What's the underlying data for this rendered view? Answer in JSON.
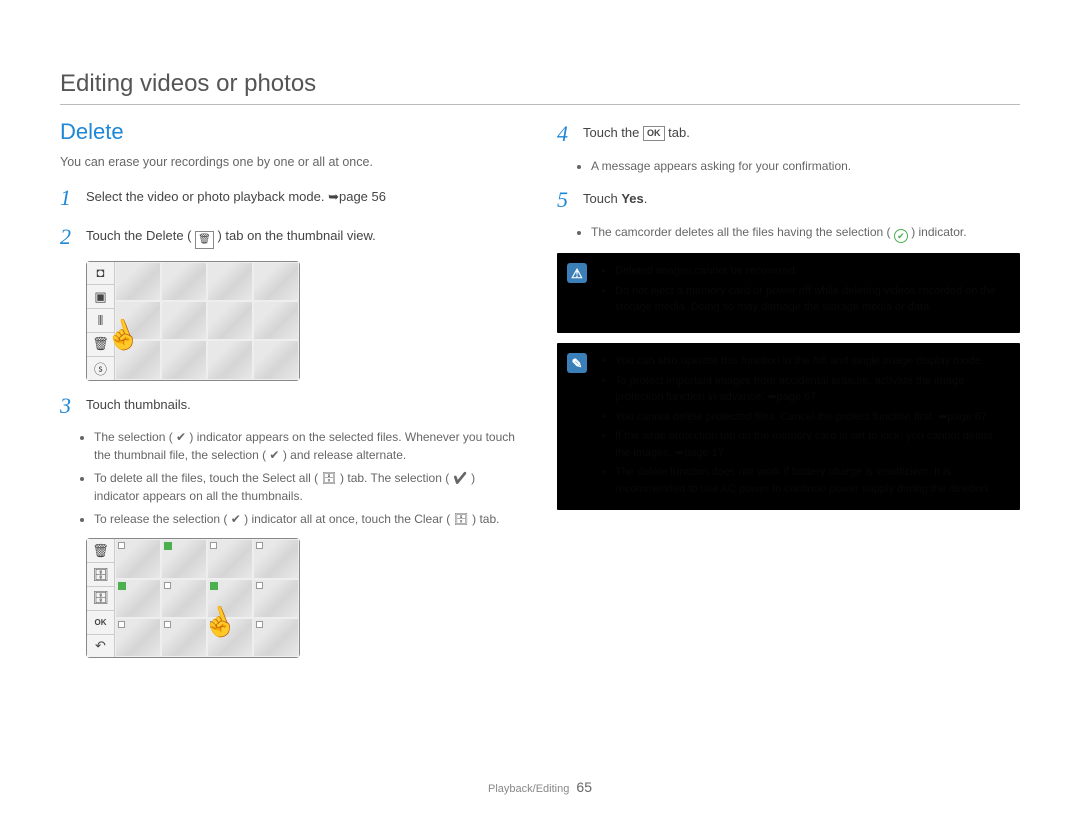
{
  "page": {
    "title": "Editing videos or photos",
    "section": "Delete",
    "intro": "You can erase your recordings one by one or all at once.",
    "footer_section": "Playback/Editing",
    "page_number": "65"
  },
  "steps": {
    "s1": "Select the video or photo playback mode. ➥page 56",
    "s2_prefix": "Touch the Delete (",
    "s2_suffix": ") tab on the thumbnail view.",
    "s3": "Touch thumbnails.",
    "s4_prefix": "Touch the ",
    "s4_suffix": " tab.",
    "s4_ok": "OK",
    "s5_prefix": "Touch ",
    "s5_bold": "Yes",
    "s5_suffix": "."
  },
  "step3_bullets": {
    "b1": "The selection ( ✔ ) indicator appears on the selected files. Whenever you touch the thumbnail file, the selection ( ✔ ) and release alternate.",
    "b2": "To delete all the files, touch the Select all ( 🗄 ) tab. The selection ( ✔ ) indicator appears on all the thumbnails.",
    "b3": "To release the selection ( ✔ ) indicator all at once, touch the Clear ( 🗄 ) tab."
  },
  "step4_bullets": {
    "b1": "A message appears asking for your confirmation."
  },
  "step5_bullets": {
    "b1_prefix": "The camcorder deletes all the files having the selection (",
    "b1_suffix": ") indicator."
  },
  "infobox_warn": {
    "items": [
      "Deleted images cannot be recovered.",
      "Do not eject a memory card or power off while deleting videos recorded on the storage media. Doing so may damage the storage media or data."
    ]
  },
  "infobox_note": {
    "items": [
      "You can also operate this function in the full and single image display mode.",
      "To protect important images from accidental erasure, activate the image protection function in advance. ➥page 67",
      "You cannot delete protected files. Cancel the protect function first. ➥page 67",
      "If the write protection tab on the memory card is set to lock, you cannot delete the images. ➥page 17",
      "The delete function does not work if battery charge is insufficient. It is recommended to use AC power to continue power supply during the deletion."
    ]
  },
  "icons": {
    "trash": "🗑",
    "camera": "◘",
    "play": "▣",
    "film": "⦀",
    "share": "ⓢ",
    "back": "↶",
    "selectall": "🗄",
    "ok": "OK"
  }
}
